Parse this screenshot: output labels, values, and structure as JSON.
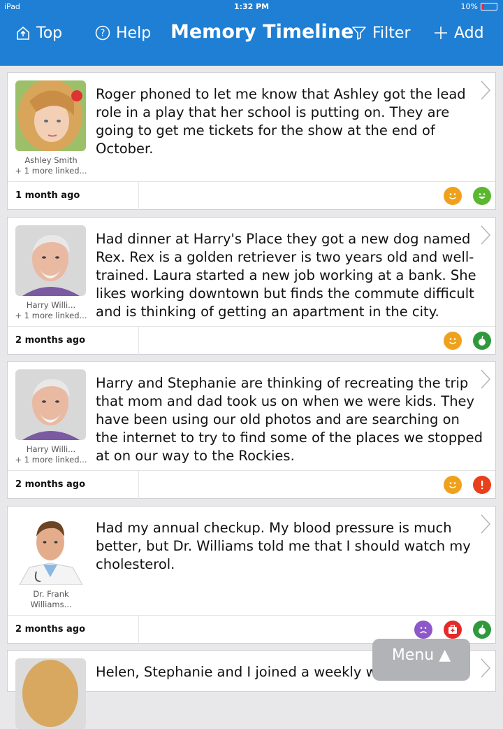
{
  "status_bar": {
    "device": "iPad",
    "time": "1:32 PM",
    "battery": "10%"
  },
  "nav": {
    "top_label": "Top",
    "help_label": "Help",
    "title": "Memory Timeline",
    "filter_label": "Filter",
    "add_label": "Add"
  },
  "cards": [
    {
      "name_line1": "Ashley Smith",
      "name_line2": "+ 1 more linked...",
      "text": "Roger phoned to let me know that Ashley got the lead role in a play that her school is putting on.  They are going to get me tickets for the show at the end of October.",
      "time": "1 month ago",
      "badges": [
        "happy-face",
        "smile-green"
      ]
    },
    {
      "name_line1": "Harry Willi...",
      "name_line2": "+ 1 more linked...",
      "text": "Had dinner at Harry's Place they got a new dog named Rex.  Rex is a golden retriever is two years old and well-trained.  Laura started a new job working at a bank.  She likes working downtown but finds the commute difficult and is thinking of getting an apartment in the city.",
      "time": "2 months ago",
      "badges": [
        "happy-face",
        "apple-green"
      ]
    },
    {
      "name_line1": "Harry Willi...",
      "name_line2": "+ 1 more linked...",
      "text": "Harry and Stephanie are thinking of recreating the trip that mom and dad took us on when we were kids.  They have been using our old photos and are searching on the internet to try to find some of the places we stopped at on our way to the Rockies.",
      "time": "2 months ago",
      "badges": [
        "happy-face",
        "exclamation-red"
      ]
    },
    {
      "name_line1": "Dr. Frank",
      "name_line2": "Williams...",
      "text": "Had my annual checkup. My blood pressure is much better, but Dr. Williams told me that I should watch my cholesterol.",
      "time": "2 months ago",
      "badges": [
        "sad-face",
        "medkit-red",
        "apple-green"
      ]
    },
    {
      "text": "Helen, Stephanie and I joined a weekly walking group"
    }
  ],
  "menu_label": "Menu ▲",
  "colors": {
    "accent": "#1f7fd4",
    "orange": "#f0a11c",
    "green": "#5ab82e",
    "red": "#e8401a",
    "purple": "#8d58c8"
  }
}
